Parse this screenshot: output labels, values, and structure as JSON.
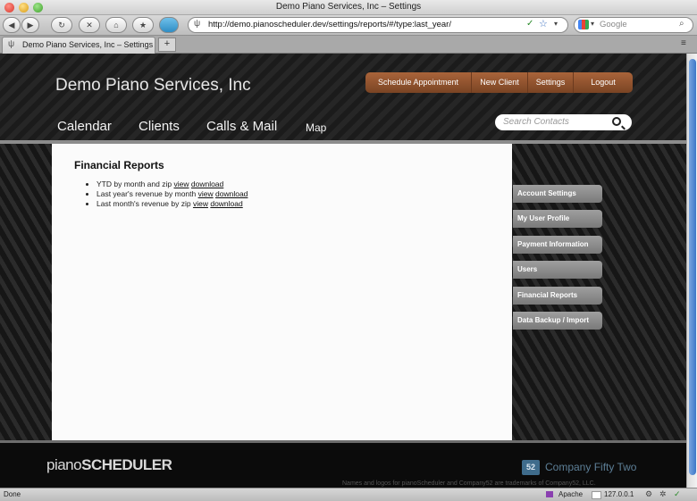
{
  "window": {
    "title": "Demo Piano Services, Inc – Settings"
  },
  "browser": {
    "url": "http://demo.pianoscheduler.dev/settings/reports/#/type:last_year/",
    "search_placeholder": "Google",
    "tab_title": "Demo Piano Services, Inc – Settings",
    "new_tab": "+"
  },
  "app": {
    "title": "Demo Piano Services, Inc",
    "top_actions": [
      "Schedule Appointment",
      "New Client",
      "Settings",
      "Logout"
    ],
    "main_nav": [
      "Calendar",
      "Clients",
      "Calls & Mail",
      "Map"
    ],
    "search_placeholder": "Search Contacts"
  },
  "content": {
    "title": "Financial Reports",
    "reports": [
      {
        "label": "YTD by month and zip",
        "view": "view",
        "download": "download"
      },
      {
        "label": "Last year's revenue by month",
        "view": "view",
        "download": "download"
      },
      {
        "label": "Last month's revenue by zip",
        "view": "view",
        "download": "download"
      }
    ]
  },
  "sidebar": {
    "items": [
      "Account Settings",
      "My User Profile",
      "Payment Information",
      "Users",
      "Financial Reports",
      "Data Backup / Import"
    ]
  },
  "footer": {
    "logo_light": "piano",
    "logo_bold": "SCHEDULER",
    "company_badge": "52",
    "company_name": "Company Fifty Two",
    "trademark": "Names and logos for pianoScheduler and Company52 are trademarks of Company52, LLC."
  },
  "status": {
    "left": "Done",
    "server": "Apache",
    "ip": "127.0.0.1"
  },
  "colors": {
    "accent": "#8a4d2b",
    "sidebar": "#8c8c8c",
    "company": "#3f6c8c"
  }
}
